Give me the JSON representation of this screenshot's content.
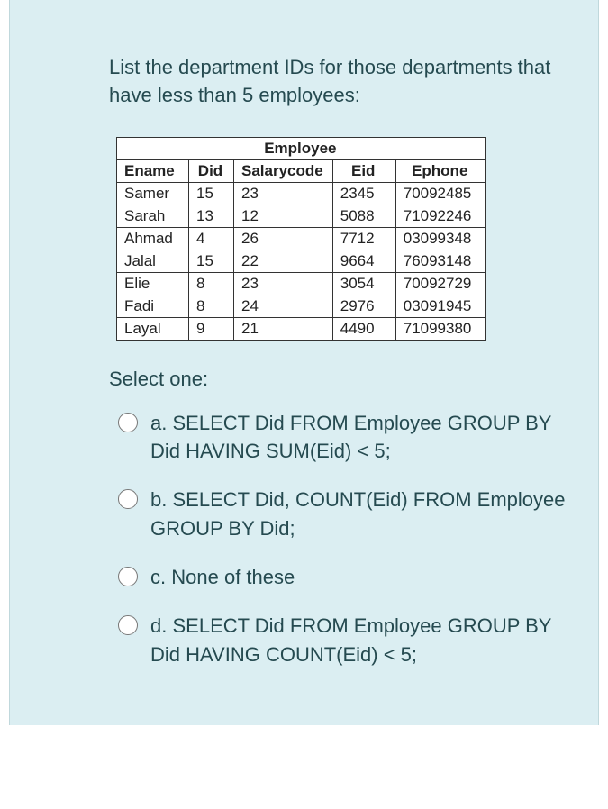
{
  "question": "List the department IDs for those departments that have less than 5 employees:",
  "table": {
    "title": "Employee",
    "headers": [
      "Ename",
      "Did",
      "Salarycode",
      "Eid",
      "Ephone"
    ],
    "rows": [
      {
        "ename": "Samer",
        "did": "15",
        "sal": "23",
        "eid": "2345",
        "ephone": "70092485"
      },
      {
        "ename": "Sarah",
        "did": "13",
        "sal": "12",
        "eid": "5088",
        "ephone": "71092246"
      },
      {
        "ename": "Ahmad",
        "did": "4",
        "sal": "26",
        "eid": "7712",
        "ephone": "03099348"
      },
      {
        "ename": "Jalal",
        "did": "15",
        "sal": "22",
        "eid": "9664",
        "ephone": "76093148"
      },
      {
        "ename": "Elie",
        "did": "8",
        "sal": "23",
        "eid": "3054",
        "ephone": "70092729"
      },
      {
        "ename": "Fadi",
        "did": "8",
        "sal": "24",
        "eid": "2976",
        "ephone": "03091945"
      },
      {
        "ename": "Layal",
        "did": "9",
        "sal": "21",
        "eid": "4490",
        "ephone": "71099380"
      }
    ]
  },
  "select_one": "Select one:",
  "options": [
    {
      "letter": "a.",
      "text": "SELECT Did FROM Employee GROUP BY Did HAVING SUM(Eid) < 5;"
    },
    {
      "letter": "b.",
      "text": "SELECT Did, COUNT(Eid) FROM Employee GROUP BY Did;"
    },
    {
      "letter": "c.",
      "text": "None of these"
    },
    {
      "letter": "d.",
      "text": "SELECT Did FROM Employee GROUP BY Did HAVING COUNT(Eid) < 5;"
    }
  ]
}
